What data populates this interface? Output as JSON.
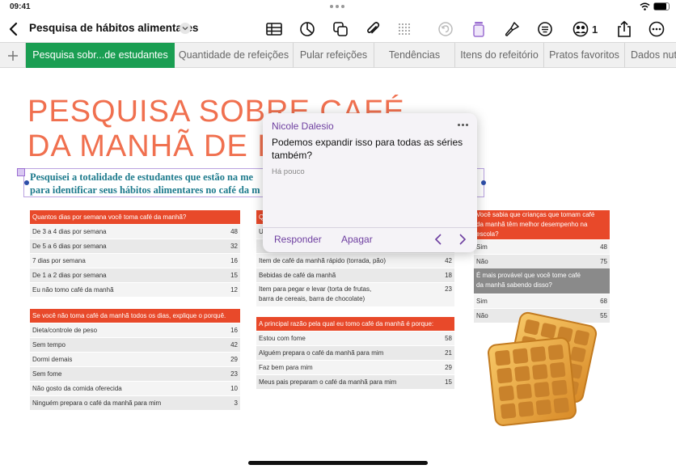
{
  "status": {
    "time": "09:41",
    "battery_level": 0.85
  },
  "toolbar": {
    "doc_title": "Pesquisa de hábitos alimentares",
    "collab_count": "1",
    "icons": [
      "back-chevron-icon",
      "table-icon",
      "chart-icon",
      "shapes-icon",
      "paperclip-icon",
      "grid-icon",
      "undo-icon",
      "text-format-icon",
      "brush-icon",
      "menu-icon",
      "collaboration-icon",
      "share-icon",
      "more-icon"
    ]
  },
  "tabs": [
    {
      "label": "Pesquisa sobr...de estudantes",
      "active": true
    },
    {
      "label": "Quantidade de refeições"
    },
    {
      "label": "Pular refeições"
    },
    {
      "label": "Tendências"
    },
    {
      "label": "Itens do refeitório"
    },
    {
      "label": "Pratos favoritos"
    },
    {
      "label": "Dados nut"
    }
  ],
  "sheet": {
    "title_line1": "PESQUISA SOBRE CAFÉ",
    "title_line2": "DA MANHÃ DE E",
    "subtitle_line1": "Pesquisei a totalidade de estudantes que estão na me",
    "subtitle_line2": "para identificar seus hábitos alimentares no café da m"
  },
  "table1": {
    "header": "Quantos dias por semana você toma café da manhã?",
    "rows": [
      {
        "label": "De 3 a 4 dias por semana",
        "value": "48"
      },
      {
        "label": "De 5 a 6 dias por semana",
        "value": "32"
      },
      {
        "label": "7 dias por semana",
        "value": "16"
      },
      {
        "label": "De 1 a 2 dias por semana",
        "value": "15"
      },
      {
        "label": "Eu não tomo café da manhã",
        "value": "12"
      }
    ]
  },
  "table2": {
    "header": "Se você não toma café da manhã todos os dias, explique o porquê.",
    "rows": [
      {
        "label": "Dieta/controle de peso",
        "value": "16"
      },
      {
        "label": "Sem tempo",
        "value": "42"
      },
      {
        "label": "Dormi demais",
        "value": "29"
      },
      {
        "label": "Sem fome",
        "value": "23"
      },
      {
        "label": "Não gosto da comida oferecida",
        "value": "10"
      },
      {
        "label": "Ninguém prepara o café da manhã para mim",
        "value": "3"
      }
    ]
  },
  "table3": {
    "header_fragment": "Q",
    "rows": [
      {
        "label": "U",
        "value": ""
      },
      {
        "label": "",
        "value": ""
      },
      {
        "label": "Item de café da manhã rápido (torrada, pão)",
        "value": "42"
      },
      {
        "label": "Bebidas de café da manhã",
        "value": "18"
      },
      {
        "label_line1": "Item para pegar e levar (torta de frutas,",
        "label_line2": "barra de cereais, barra de chocolate)",
        "value": "23"
      }
    ]
  },
  "table4": {
    "header": "A principal razão pela qual eu tomo café da manhã é porque:",
    "rows": [
      {
        "label": "Estou com fome",
        "value": "58"
      },
      {
        "label": "Alguém prepara o café da manhã para mim",
        "value": "21"
      },
      {
        "label": "Faz bem para mim",
        "value": "29"
      },
      {
        "label": "Meus pais preparam o café da manhã para mim",
        "value": "15"
      }
    ]
  },
  "table5": {
    "header_line1": "Você sabia que crianças que tomam café",
    "header_line2": "da manhã têm melhor desempenho na escola?",
    "rows": [
      {
        "label": "Sim",
        "value": "48"
      },
      {
        "label": "Não",
        "value": "75"
      }
    ]
  },
  "table6": {
    "header_line1": "É mais provável que você tome café",
    "header_line2": "da manhã sabendo disso?",
    "rows": [
      {
        "label": "Sim",
        "value": "68"
      },
      {
        "label": "Não",
        "value": "55"
      }
    ]
  },
  "comment": {
    "author": "Nicole Dalesio",
    "text_line1": "Podemos expandir isso para todas as séries",
    "text_line2": "também?",
    "time": "Há pouco",
    "reply_label": "Responder",
    "delete_label": "Apagar"
  },
  "colors": {
    "accent_green": "#1a9e52",
    "title_orange": "#f0704f",
    "table_header_red": "#e8492a",
    "subtitle_teal": "#1d7a8c",
    "comment_purple": "#6e3fa0"
  }
}
